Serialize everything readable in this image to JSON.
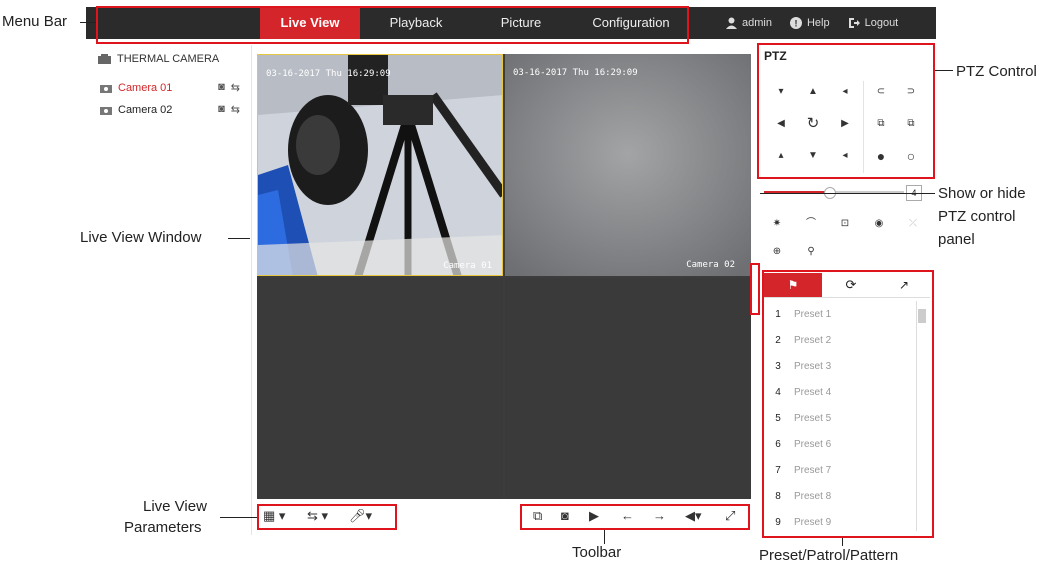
{
  "annotations": {
    "menu_bar": "Menu Bar",
    "ptz_control": "PTZ Control",
    "show_hide_line1": "Show or hide",
    "show_hide_line2": "PTZ control",
    "show_hide_line3": "panel",
    "live_view_window": "Live View Window",
    "live_view_params_line1": "Live View",
    "live_view_params_line2": "Parameters",
    "toolbar": "Toolbar",
    "preset_patrol_pattern": "Preset/Patrol/Pattern"
  },
  "menubar": {
    "tabs": [
      "Live View",
      "Playback",
      "Picture",
      "Configuration"
    ],
    "active_tab": "Live View",
    "user": "admin",
    "help": "Help",
    "logout": "Logout",
    "accent": "#d4262a"
  },
  "sidebar": {
    "group": "THERMAL CAMERA",
    "cameras": [
      {
        "label": "Camera 01",
        "selected": true
      },
      {
        "label": "Camera 02",
        "selected": false
      }
    ]
  },
  "video": {
    "cell1": {
      "timestamp": "03-16-2017 Thu 16:29:09",
      "channel": "Camera 01"
    },
    "cell2": {
      "timestamp": "03-16-2017 Thu 16:29:09",
      "channel": "Camera 02"
    }
  },
  "ptz": {
    "title": "PTZ",
    "speed_value": "4"
  },
  "presets": [
    {
      "num": "1",
      "name": "Preset 1"
    },
    {
      "num": "2",
      "name": "Preset 2"
    },
    {
      "num": "3",
      "name": "Preset 3"
    },
    {
      "num": "4",
      "name": "Preset 4"
    },
    {
      "num": "5",
      "name": "Preset 5"
    },
    {
      "num": "6",
      "name": "Preset 6"
    },
    {
      "num": "7",
      "name": "Preset 7"
    },
    {
      "num": "8",
      "name": "Preset 8"
    },
    {
      "num": "9",
      "name": "Preset 9"
    }
  ]
}
